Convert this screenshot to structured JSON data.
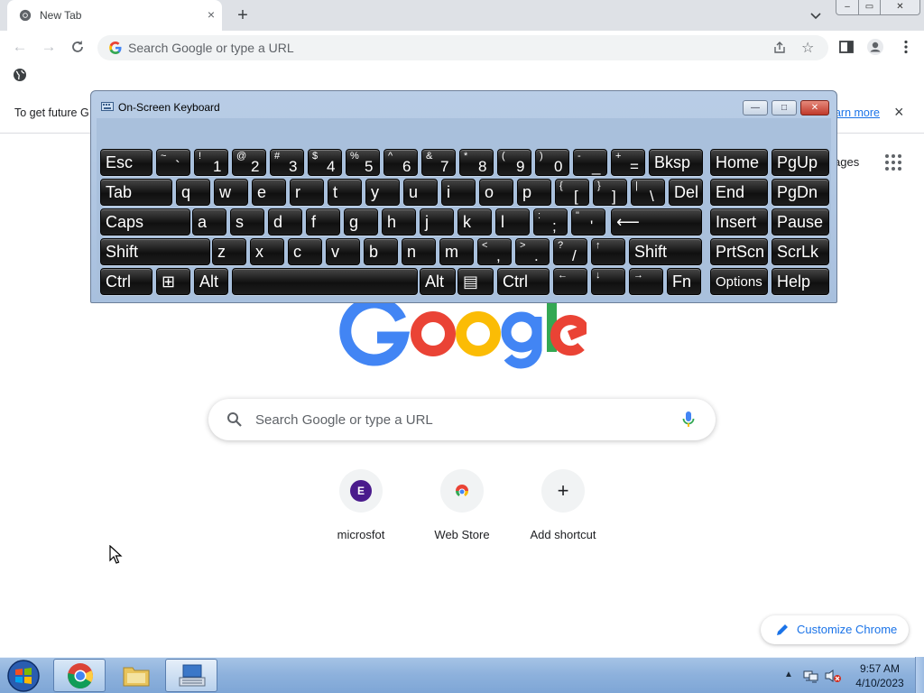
{
  "browser": {
    "tab_title": "New Tab",
    "tab_close": "×",
    "new_tab": "+",
    "omnibox_placeholder": "Search Google or type a URL",
    "infobar_text": "To get future G",
    "infobar_link": "earn more",
    "infobar_close": "×",
    "window_buttons": {
      "minimize": "‒",
      "maximize": "▭",
      "close": "✕"
    }
  },
  "ntp": {
    "images_link": "ages",
    "search_placeholder": "Search Google or type a URL",
    "shortcuts": [
      {
        "label": "microsfot",
        "initial": "E"
      },
      {
        "label": "Web Store"
      },
      {
        "label": "Add shortcut",
        "glyph": "+"
      }
    ],
    "customize": "Customize Chrome"
  },
  "osk": {
    "title": "On-Screen Keyboard",
    "controls": {
      "minimize": "—",
      "maximize": "□",
      "close": "✕"
    },
    "rows": [
      [
        {
          "main": "Esc"
        },
        {
          "shift": "~",
          "base": "`"
        },
        {
          "shift": "!",
          "base": "1"
        },
        {
          "shift": "@",
          "base": "2"
        },
        {
          "shift": "#",
          "base": "3"
        },
        {
          "shift": "$",
          "base": "4"
        },
        {
          "shift": "%",
          "base": "5"
        },
        {
          "shift": "^",
          "base": "6"
        },
        {
          "shift": "&",
          "base": "7"
        },
        {
          "shift": "*",
          "base": "8"
        },
        {
          "shift": "(",
          "base": "9"
        },
        {
          "shift": ")",
          "base": "0"
        },
        {
          "shift": "-",
          "base": "_"
        },
        {
          "shift": "+",
          "base": "="
        },
        {
          "main": "Bksp"
        },
        {
          "main": "Home"
        },
        {
          "main": "PgUp"
        }
      ],
      [
        {
          "main": "Tab"
        },
        {
          "main": "q"
        },
        {
          "main": "w"
        },
        {
          "main": "e"
        },
        {
          "main": "r"
        },
        {
          "main": "t"
        },
        {
          "main": "y"
        },
        {
          "main": "u"
        },
        {
          "main": "i"
        },
        {
          "main": "o"
        },
        {
          "main": "p"
        },
        {
          "shift": "{",
          "base": "["
        },
        {
          "shift": "}",
          "base": "]"
        },
        {
          "shift": "|",
          "base": "\\"
        },
        {
          "main": "Del"
        },
        {
          "main": "End"
        },
        {
          "main": "PgDn"
        }
      ],
      [
        {
          "main": "Caps"
        },
        {
          "main": "a"
        },
        {
          "main": "s"
        },
        {
          "main": "d"
        },
        {
          "main": "f"
        },
        {
          "main": "g"
        },
        {
          "main": "h"
        },
        {
          "main": "j"
        },
        {
          "main": "k"
        },
        {
          "main": "l"
        },
        {
          "shift": ":",
          "base": ";"
        },
        {
          "shift": "\"",
          "base": "'"
        },
        {
          "main": "⟵"
        },
        {
          "main": "Insert"
        },
        {
          "main": "Pause"
        }
      ],
      [
        {
          "main": "Shift"
        },
        {
          "main": "z"
        },
        {
          "main": "x"
        },
        {
          "main": "c"
        },
        {
          "main": "v"
        },
        {
          "main": "b"
        },
        {
          "main": "n"
        },
        {
          "main": "m"
        },
        {
          "shift": "<",
          "base": ","
        },
        {
          "shift": ">",
          "base": "."
        },
        {
          "shift": "?",
          "base": "/"
        },
        {
          "shift": "↑",
          "base": ""
        },
        {
          "main": "Shift"
        },
        {
          "main": "PrtScn"
        },
        {
          "main": "ScrLk"
        }
      ],
      [
        {
          "main": "Ctrl"
        },
        {
          "main": "⊞"
        },
        {
          "main": "Alt"
        },
        {
          "main": ""
        },
        {
          "main": "Alt"
        },
        {
          "main": "▤"
        },
        {
          "main": "Ctrl"
        },
        {
          "shift": "←",
          "base": ""
        },
        {
          "shift": "↓",
          "base": ""
        },
        {
          "shift": "→",
          "base": ""
        },
        {
          "main": "Fn"
        },
        {
          "main": "Options"
        },
        {
          "main": "Help"
        }
      ]
    ]
  },
  "taskbar": {
    "time": "9:57 AM",
    "date": "4/10/2023",
    "tray_arrow": "▲"
  }
}
